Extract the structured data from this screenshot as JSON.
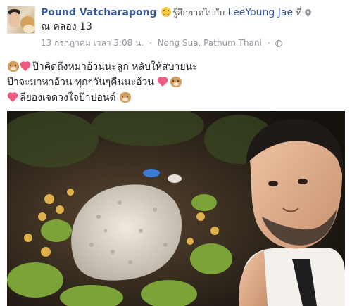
{
  "post": {
    "author": "Pound Vatcharapong",
    "feeling_text": "รู้สึกยาดไปกับ",
    "feeling_icon": "smiley-feeling-icon",
    "tagged_person": "LeeYoung Jae",
    "at_text": "ที่",
    "location_icon": "map-pin-icon",
    "location_name": "ณ คลอง 13",
    "timestamp": "13 กรกฎาคม เวลา 3:08 น.",
    "dot": "·",
    "place": "Nong Sua, Pathum Thani",
    "privacy_icon": "globe-icon",
    "text_lines": [
      "ป๊าคิดถึงหมาอ้วนนะลูก หลับให้สบายนะ",
      "ป๊าจะมาหาอ้วน ทุกๆวันๆคืนนะอ้วน",
      "ลียองเจดวงใจป๊าปอนด์"
    ],
    "emoji": [
      "dog-face-emoji",
      "heart-emoji"
    ]
  },
  "photo": {
    "description_icon": "photo-grave-selfie",
    "colors": {
      "ground": "#2a221a",
      "stones": "#d8d2c9",
      "flowers": "#e0b14a",
      "leaves": "#7ba338",
      "skin": "#e3b594"
    }
  }
}
